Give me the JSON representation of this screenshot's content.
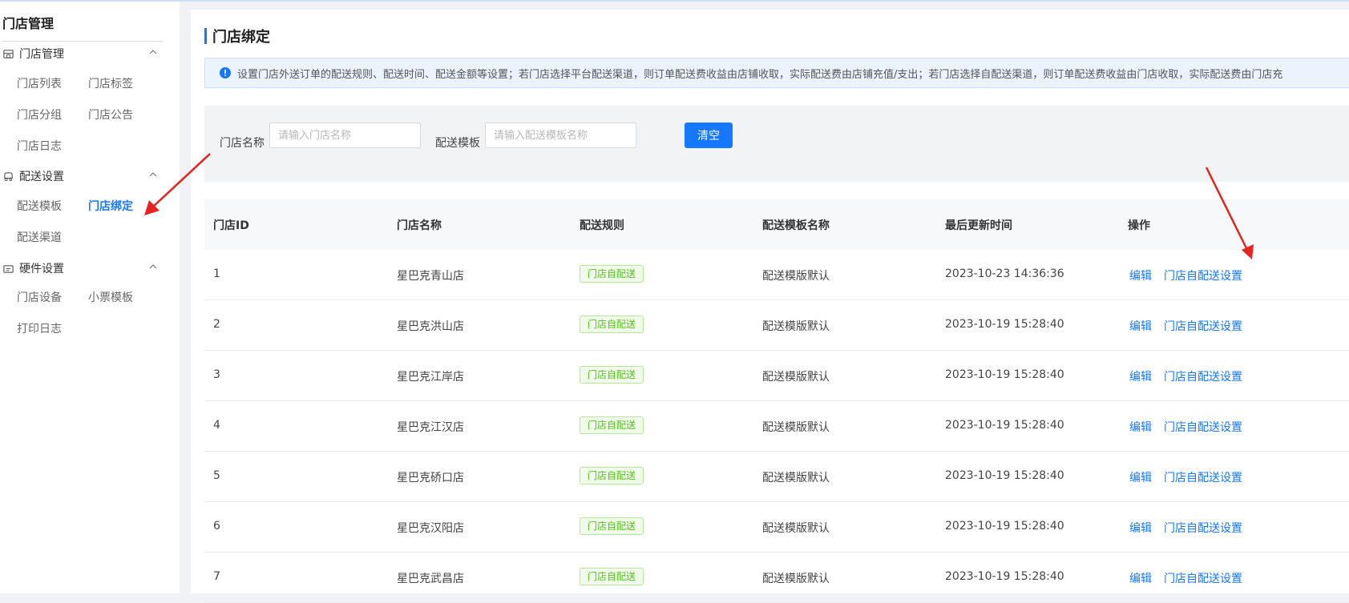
{
  "sidebar": {
    "title": "门店管理",
    "groups": [
      {
        "label": "门店管理",
        "items": [
          "门店列表",
          "门店标签",
          "门店分组",
          "门店公告",
          "门店日志"
        ]
      },
      {
        "label": "配送设置",
        "items": [
          "配送模板",
          "门店绑定",
          "配送渠道"
        ]
      },
      {
        "label": "硬件设置",
        "items": [
          "门店设备",
          "小票模板",
          "打印日志"
        ]
      }
    ],
    "active_item": "门店绑定"
  },
  "main": {
    "title": "门店绑定",
    "notice": "设置门店外送订单的配送规则、配送时间、配送金额等设置；若门店选择平台配送渠道，则订单配送费收益由店铺收取，实际配送费由店铺充值/支出；若门店选择自配送渠道，则订单配送费收益由门店收取，实际配送费由门店充"
  },
  "filter": {
    "store_name_label": "门店名称",
    "store_name_placeholder": "请输入门店名称",
    "template_label": "配送模板",
    "template_placeholder": "请输入配送模板名称",
    "clear_label": "清空"
  },
  "table": {
    "columns": [
      "门店ID",
      "门店名称",
      "配送规则",
      "配送模板名称",
      "最后更新时间",
      "操作"
    ],
    "rows": [
      {
        "id": "1",
        "name": "星巴克青山店",
        "rule": "门店自配送",
        "template": "配送模版默认",
        "updated": "2023-10-23 14:36:36"
      },
      {
        "id": "2",
        "name": "星巴克洪山店",
        "rule": "门店自配送",
        "template": "配送模版默认",
        "updated": "2023-10-19 15:28:40"
      },
      {
        "id": "3",
        "name": "星巴克江岸店",
        "rule": "门店自配送",
        "template": "配送模版默认",
        "updated": "2023-10-19 15:28:40"
      },
      {
        "id": "4",
        "name": "星巴克江汉店",
        "rule": "门店自配送",
        "template": "配送模版默认",
        "updated": "2023-10-19 15:28:40"
      },
      {
        "id": "5",
        "name": "星巴克硚口店",
        "rule": "门店自配送",
        "template": "配送模版默认",
        "updated": "2023-10-19 15:28:40"
      },
      {
        "id": "6",
        "name": "星巴克汉阳店",
        "rule": "门店自配送",
        "template": "配送模版默认",
        "updated": "2023-10-19 15:28:40"
      },
      {
        "id": "7",
        "name": "星巴克武昌店",
        "rule": "门店自配送",
        "template": "配送模版默认",
        "updated": "2023-10-19 15:28:40"
      }
    ],
    "actions": {
      "edit": "编辑",
      "self_delivery": "门店自配送设置"
    }
  },
  "colors": {
    "accent": "#1677ff",
    "tag_green": "#52c41a",
    "annotation_arrow": "#e8231f"
  }
}
